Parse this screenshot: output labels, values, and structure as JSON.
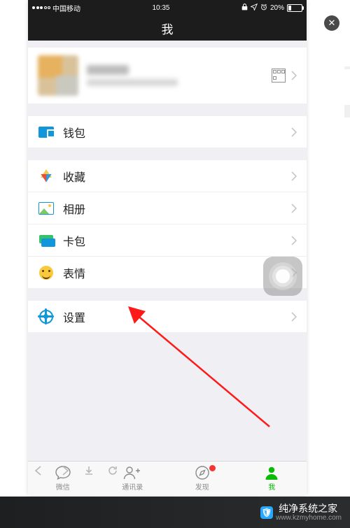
{
  "statusbar": {
    "carrier": "中国移动",
    "time": "10:35",
    "battery_pct": "20%"
  },
  "navbar": {
    "title": "我"
  },
  "menu": {
    "wallet": "钱包",
    "favorites": "收藏",
    "album": "相册",
    "cards": "卡包",
    "stickers": "表情",
    "settings": "设置"
  },
  "tabs": {
    "chats": "微信",
    "contacts": "通讯录",
    "discover": "发现",
    "me": "我"
  },
  "watermark": {
    "site_name": "纯净系统之家",
    "url": "www.kzmyhome.com"
  }
}
